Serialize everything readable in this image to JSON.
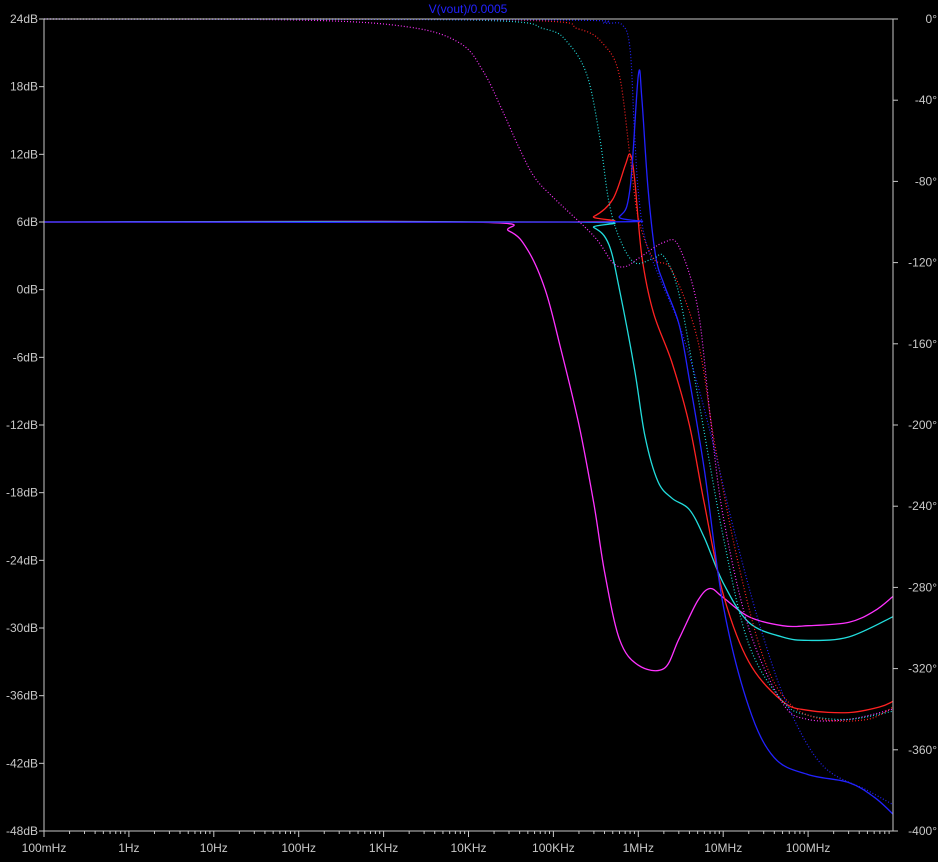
{
  "chart_data": {
    "type": "line",
    "title": "V(vout)/0.0005",
    "title_color": "#2222ff",
    "background": "#000000",
    "frame_color": "#c8c8c8",
    "xscale": "log",
    "xlim": [
      0.1,
      1000000000
    ],
    "xticks": [
      {
        "value": 0.1,
        "label": "100mHz"
      },
      {
        "value": 1,
        "label": "1Hz"
      },
      {
        "value": 10,
        "label": "10Hz"
      },
      {
        "value": 100,
        "label": "100Hz"
      },
      {
        "value": 1000,
        "label": "1KHz"
      },
      {
        "value": 10000,
        "label": "10KHz"
      },
      {
        "value": 100000,
        "label": "100KHz"
      },
      {
        "value": 1000000,
        "label": "1MHz"
      },
      {
        "value": 10000000,
        "label": "10MHz"
      },
      {
        "value": 100000000,
        "label": "100MHz"
      }
    ],
    "ylim": [
      -48,
      24
    ],
    "yticks": [
      {
        "value": 24,
        "label": "24dB"
      },
      {
        "value": 18,
        "label": "18dB"
      },
      {
        "value": 12,
        "label": "12dB"
      },
      {
        "value": 6,
        "label": "6dB"
      },
      {
        "value": 0,
        "label": "0dB"
      },
      {
        "value": -6,
        "label": "-6dB"
      },
      {
        "value": -12,
        "label": "-12dB"
      },
      {
        "value": -18,
        "label": "-18dB"
      },
      {
        "value": -24,
        "label": "-24dB"
      },
      {
        "value": -30,
        "label": "-30dB"
      },
      {
        "value": -36,
        "label": "-36dB"
      },
      {
        "value": -42,
        "label": "-42dB"
      },
      {
        "value": -48,
        "label": "-48dB"
      }
    ],
    "y2lim": [
      -400,
      0
    ],
    "y2ticks": [
      {
        "value": 0,
        "label": "0°"
      },
      {
        "value": -40,
        "label": "-40°"
      },
      {
        "value": -80,
        "label": "-80°"
      },
      {
        "value": -120,
        "label": "-120°"
      },
      {
        "value": -160,
        "label": "-160°"
      },
      {
        "value": -200,
        "label": "-200°"
      },
      {
        "value": -240,
        "label": "-240°"
      },
      {
        "value": -280,
        "label": "-280°"
      },
      {
        "value": -320,
        "label": "-320°"
      },
      {
        "value": -360,
        "label": "-360°"
      },
      {
        "value": -400,
        "label": "-400°"
      }
    ],
    "grid": false,
    "series": [
      {
        "color": "#ff33ff",
        "kind": "magnitude",
        "axis": "left",
        "points": [
          [
            0.1,
            6
          ],
          [
            10000,
            6
          ],
          [
            30000,
            5.2
          ],
          [
            50000,
            3.5
          ],
          [
            80000,
            0
          ],
          [
            120000,
            -5
          ],
          [
            200000,
            -12
          ],
          [
            300000,
            -19
          ],
          [
            400000,
            -25
          ],
          [
            600000,
            -31
          ],
          [
            1000000,
            -33.3
          ],
          [
            2000000,
            -33.6
          ],
          [
            3000000,
            -31
          ],
          [
            5000000,
            -27.6
          ],
          [
            7000000,
            -26.5
          ],
          [
            10000000,
            -27.3
          ],
          [
            20000000,
            -29
          ],
          [
            50000000,
            -29.8
          ],
          [
            100000000,
            -29.8
          ],
          [
            300000000,
            -29.5
          ],
          [
            600000000,
            -28.5
          ],
          [
            1000000000,
            -27.2
          ]
        ]
      },
      {
        "color": "#22dddd",
        "kind": "magnitude",
        "axis": "left",
        "points": [
          [
            0.1,
            6
          ],
          [
            150000,
            6
          ],
          [
            300000,
            5.5
          ],
          [
            450000,
            4
          ],
          [
            600000,
            0
          ],
          [
            900000,
            -7
          ],
          [
            1200000,
            -13
          ],
          [
            1700000,
            -17
          ],
          [
            2500000,
            -18.5
          ],
          [
            4000000,
            -19.5
          ],
          [
            6000000,
            -22
          ],
          [
            10000000,
            -26
          ],
          [
            20000000,
            -29.5
          ],
          [
            50000000,
            -30.8
          ],
          [
            100000000,
            -31.1
          ],
          [
            300000000,
            -30.8
          ],
          [
            1000000000,
            -29
          ]
        ]
      },
      {
        "color": "#ff2222",
        "kind": "magnitude",
        "axis": "left",
        "points": [
          [
            0.1,
            6
          ],
          [
            150000,
            6
          ],
          [
            300000,
            6.5
          ],
          [
            500000,
            8
          ],
          [
            700000,
            11
          ],
          [
            800000,
            12
          ],
          [
            900000,
            10
          ],
          [
            1100000,
            3
          ],
          [
            1500000,
            -2
          ],
          [
            2500000,
            -6.5
          ],
          [
            4000000,
            -12
          ],
          [
            6000000,
            -19
          ],
          [
            10000000,
            -27
          ],
          [
            20000000,
            -33
          ],
          [
            50000000,
            -36.5
          ],
          [
            100000000,
            -37.3
          ],
          [
            300000000,
            -37.5
          ],
          [
            700000000,
            -37
          ],
          [
            1000000000,
            -36.5
          ]
        ]
      },
      {
        "color": "#2222ff",
        "kind": "magnitude",
        "axis": "left",
        "points": [
          [
            0.1,
            6
          ],
          [
            300000,
            6
          ],
          [
            600000,
            6.5
          ],
          [
            800000,
            9
          ],
          [
            1000000,
            19
          ],
          [
            1100000,
            17
          ],
          [
            1300000,
            9
          ],
          [
            1600000,
            3
          ],
          [
            2000000,
            0.5
          ],
          [
            3000000,
            -3
          ],
          [
            4000000,
            -8
          ],
          [
            6000000,
            -16
          ],
          [
            10000000,
            -28
          ],
          [
            20000000,
            -37
          ],
          [
            40000000,
            -41.5
          ],
          [
            100000000,
            -43
          ],
          [
            300000000,
            -43.7
          ],
          [
            600000000,
            -45
          ],
          [
            1000000000,
            -46.5
          ]
        ]
      },
      {
        "color": "#ff33ff",
        "kind": "phase",
        "axis": "right",
        "points": [
          [
            0.1,
            0
          ],
          [
            100,
            -0.5
          ],
          [
            2000,
            -4
          ],
          [
            8000,
            -12
          ],
          [
            15000,
            -26
          ],
          [
            25000,
            -45
          ],
          [
            40000,
            -64
          ],
          [
            60000,
            -78
          ],
          [
            100000,
            -88
          ],
          [
            300000,
            -107
          ],
          [
            500000,
            -120
          ],
          [
            700000,
            -122
          ],
          [
            1000000,
            -118
          ],
          [
            2000000,
            -110
          ],
          [
            3000000,
            -112
          ],
          [
            5000000,
            -142
          ],
          [
            7000000,
            -195
          ],
          [
            10000000,
            -245
          ],
          [
            20000000,
            -300
          ],
          [
            50000000,
            -337
          ],
          [
            100000000,
            -345
          ],
          [
            300000000,
            -345
          ],
          [
            1000000000,
            -340
          ]
        ]
      },
      {
        "color": "#22dddd",
        "kind": "phase",
        "axis": "right",
        "points": [
          [
            0.1,
            0
          ],
          [
            10000,
            -0.5
          ],
          [
            80000,
            -5
          ],
          [
            150000,
            -12
          ],
          [
            250000,
            -28
          ],
          [
            350000,
            -58
          ],
          [
            450000,
            -90
          ],
          [
            600000,
            -108
          ],
          [
            900000,
            -120
          ],
          [
            1500000,
            -118
          ],
          [
            2000000,
            -117
          ],
          [
            3000000,
            -135
          ],
          [
            5000000,
            -185
          ],
          [
            10000000,
            -255
          ],
          [
            20000000,
            -308
          ],
          [
            50000000,
            -336
          ],
          [
            100000000,
            -343
          ],
          [
            300000000,
            -345
          ],
          [
            1000000000,
            -341
          ]
        ]
      },
      {
        "color": "#ff2222",
        "kind": "phase",
        "axis": "right",
        "points": [
          [
            0.1,
            0
          ],
          [
            30000,
            -0.5
          ],
          [
            200000,
            -5
          ],
          [
            400000,
            -13
          ],
          [
            600000,
            -28
          ],
          [
            800000,
            -68
          ],
          [
            1000000,
            -98
          ],
          [
            1500000,
            -118
          ],
          [
            2500000,
            -124
          ],
          [
            5000000,
            -158
          ],
          [
            8000000,
            -210
          ],
          [
            15000000,
            -268
          ],
          [
            30000000,
            -315
          ],
          [
            60000000,
            -337
          ],
          [
            150000000,
            -345
          ],
          [
            500000000,
            -345
          ],
          [
            1000000000,
            -339
          ]
        ]
      },
      {
        "color": "#2222ff",
        "kind": "phase",
        "axis": "right",
        "points": [
          [
            0.1,
            0
          ],
          [
            100000,
            -0.5
          ],
          [
            400000,
            -2
          ],
          [
            650000,
            -3
          ],
          [
            800000,
            -15
          ],
          [
            900000,
            -55
          ],
          [
            1000000,
            -85
          ],
          [
            1200000,
            -108
          ],
          [
            1800000,
            -128
          ],
          [
            3000000,
            -150
          ],
          [
            5000000,
            -180
          ],
          [
            8000000,
            -213
          ],
          [
            15000000,
            -260
          ],
          [
            30000000,
            -305
          ],
          [
            60000000,
            -340
          ],
          [
            150000000,
            -368
          ],
          [
            500000000,
            -380
          ],
          [
            1000000000,
            -387
          ]
        ]
      }
    ]
  }
}
